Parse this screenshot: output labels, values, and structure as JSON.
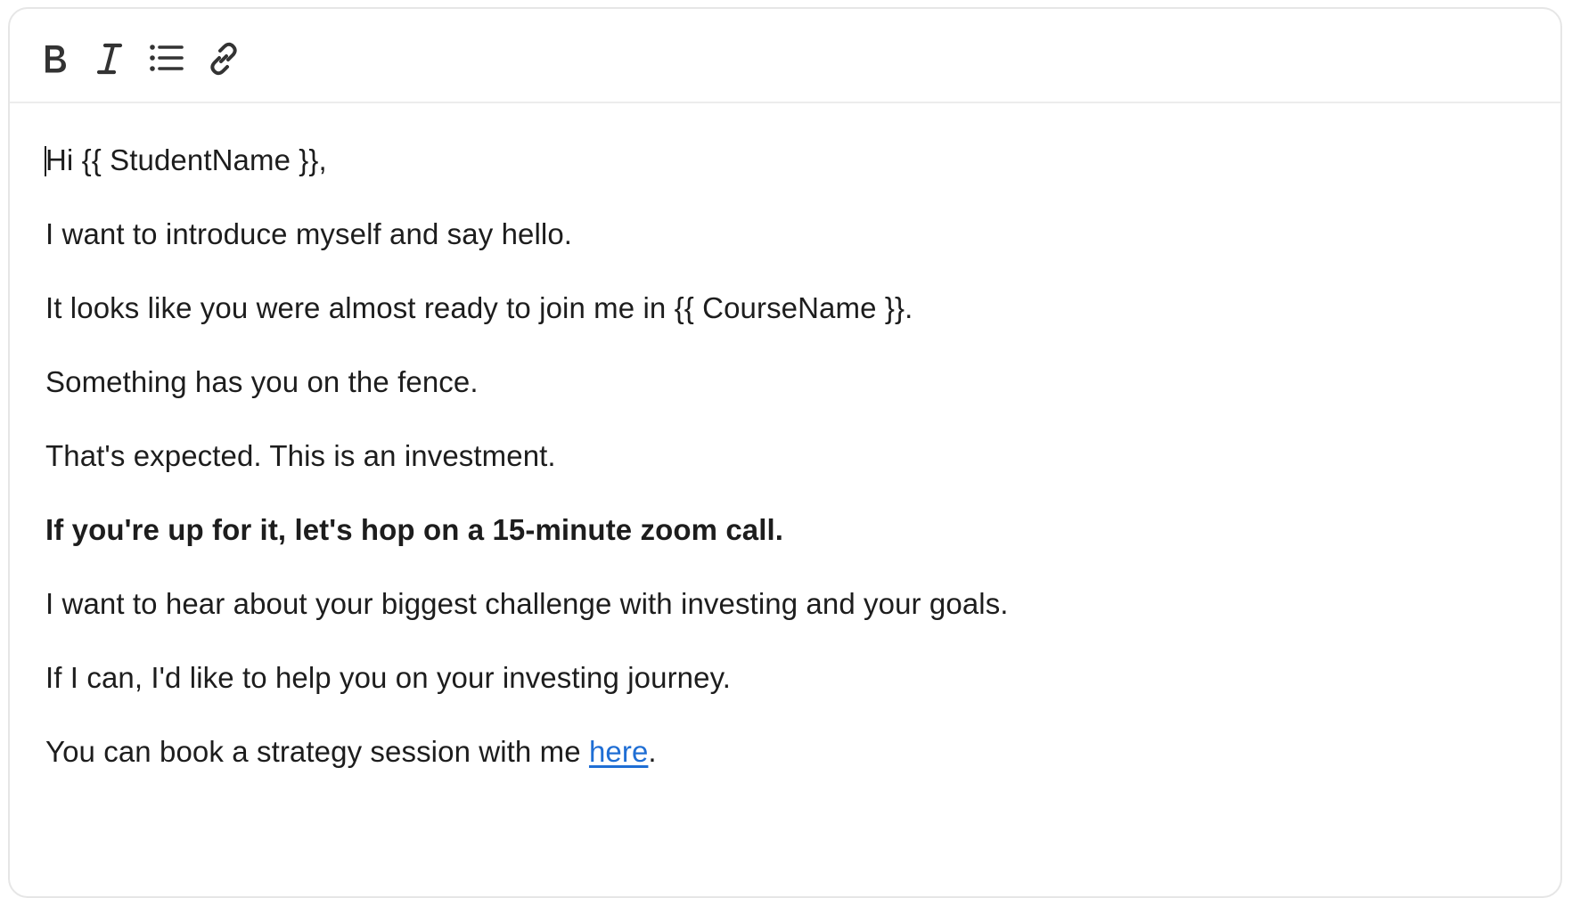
{
  "toolbar": {
    "buttons": [
      {
        "name": "bold",
        "icon": "bold-icon"
      },
      {
        "name": "italic",
        "icon": "italic-icon"
      },
      {
        "name": "bulleted-list",
        "icon": "bulleted-list-icon"
      },
      {
        "name": "link",
        "icon": "link-icon"
      }
    ]
  },
  "body": {
    "greeting": "Hi {{ StudentName }},",
    "p1": "I want to introduce myself and say hello.",
    "p2": "It looks like you were almost ready to join me in {{ CourseName }}.",
    "p3": "Something has you on the fence.",
    "p4": "That's expected. This is an investment.",
    "p5_bold": "If you're up for it, let's hop on a 15-minute zoom call.",
    "p6": "I want to hear about your biggest challenge with investing and your goals.",
    "p7": "If I can, I'd like to help you on your investing journey.",
    "p8_prefix": "You can book a strategy session with me ",
    "p8_link": "here",
    "p8_suffix": "."
  },
  "colors": {
    "text": "#1d1d1d",
    "link": "#1f6ed4",
    "border": "#e6e6e6"
  }
}
